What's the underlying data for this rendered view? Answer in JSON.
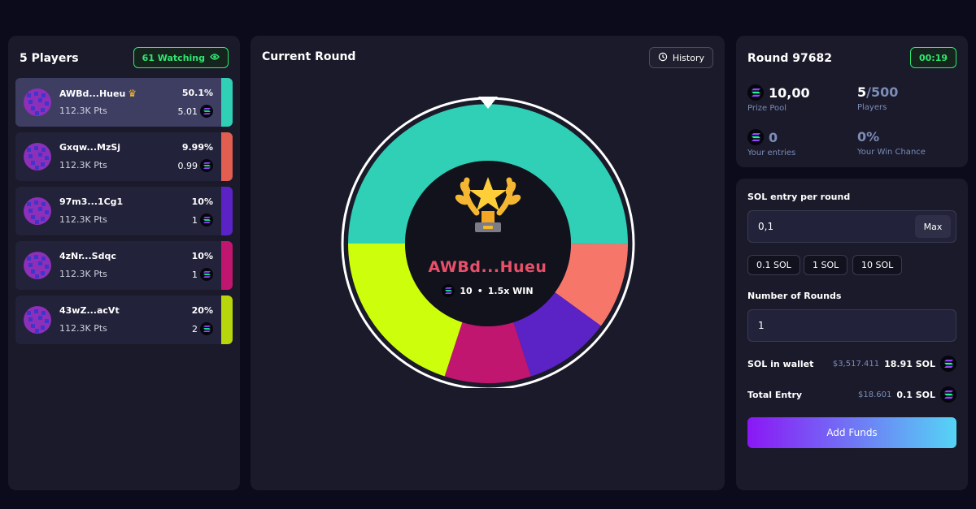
{
  "left": {
    "title": "5 Players",
    "watching": "61 Watching",
    "players": [
      {
        "name": "AWBd...Hueu",
        "pct": "50.1%",
        "pts": "112.3K Pts",
        "sol": "5.01",
        "color": "#2fd0b5",
        "active": true
      },
      {
        "name": "Gxqw...MzSj",
        "pct": "9.99%",
        "pts": "112.3K Pts",
        "sol": "0.99",
        "color": "#e15e50"
      },
      {
        "name": "97m3...1Cg1",
        "pct": "10%",
        "pts": "112.3K Pts",
        "sol": "1",
        "color": "#5b22c6"
      },
      {
        "name": "4zNr...Sdqc",
        "pct": "10%",
        "pts": "112.3K Pts",
        "sol": "1",
        "color": "#c0166f"
      },
      {
        "name": "43wZ...acVt",
        "pct": "20%",
        "pts": "112.3K Pts",
        "sol": "2",
        "color": "#b7d60c"
      }
    ]
  },
  "center": {
    "title": "Current Round",
    "history_label": "History",
    "wheel": {
      "segments": [
        {
          "name": "AWBd...Hueu",
          "share": 50.1,
          "color": "#2fd0b5"
        },
        {
          "name": "Gxqw...MzSj",
          "share": 9.99,
          "color": "#f7766a"
        },
        {
          "name": "97m3...1Cg1",
          "share": 10,
          "color": "#5b22c6"
        },
        {
          "name": "4zNr...Sdqc",
          "share": 10,
          "color": "#c0166f"
        },
        {
          "name": "43wZ...acVt",
          "share": 20,
          "color": "#cdff0c"
        }
      ]
    },
    "winner": {
      "name": "AWBd...Hueu",
      "amount": "10",
      "sep": "•",
      "multiplier": "1.5x WIN"
    }
  },
  "stats": {
    "round": "Round 97682",
    "timer": "00:19",
    "prize_pool_value": "10,00",
    "prize_pool_label": "Prize Pool",
    "players_value": "5",
    "players_max": "/500",
    "players_label": "Players",
    "entries_value": "0",
    "entries_label": "Your entries",
    "win_chance_value": "0%",
    "win_chance_label": "Your Win Chance"
  },
  "entry": {
    "sol_entry_label": "SOL entry per round",
    "sol_entry_value": "0,1",
    "max_label": "Max",
    "quick": [
      "0.1 SOL",
      "1 SOL",
      "10 SOL"
    ],
    "rounds_label": "Number of Rounds",
    "rounds_value": "1",
    "wallet_label": "SOL in wallet",
    "wallet_usd": "$3,517.411",
    "wallet_sol": "18.91 SOL",
    "total_label": "Total Entry",
    "total_usd": "$18.601",
    "total_sol": "0.1 SOL",
    "add_funds": "Add Funds"
  }
}
